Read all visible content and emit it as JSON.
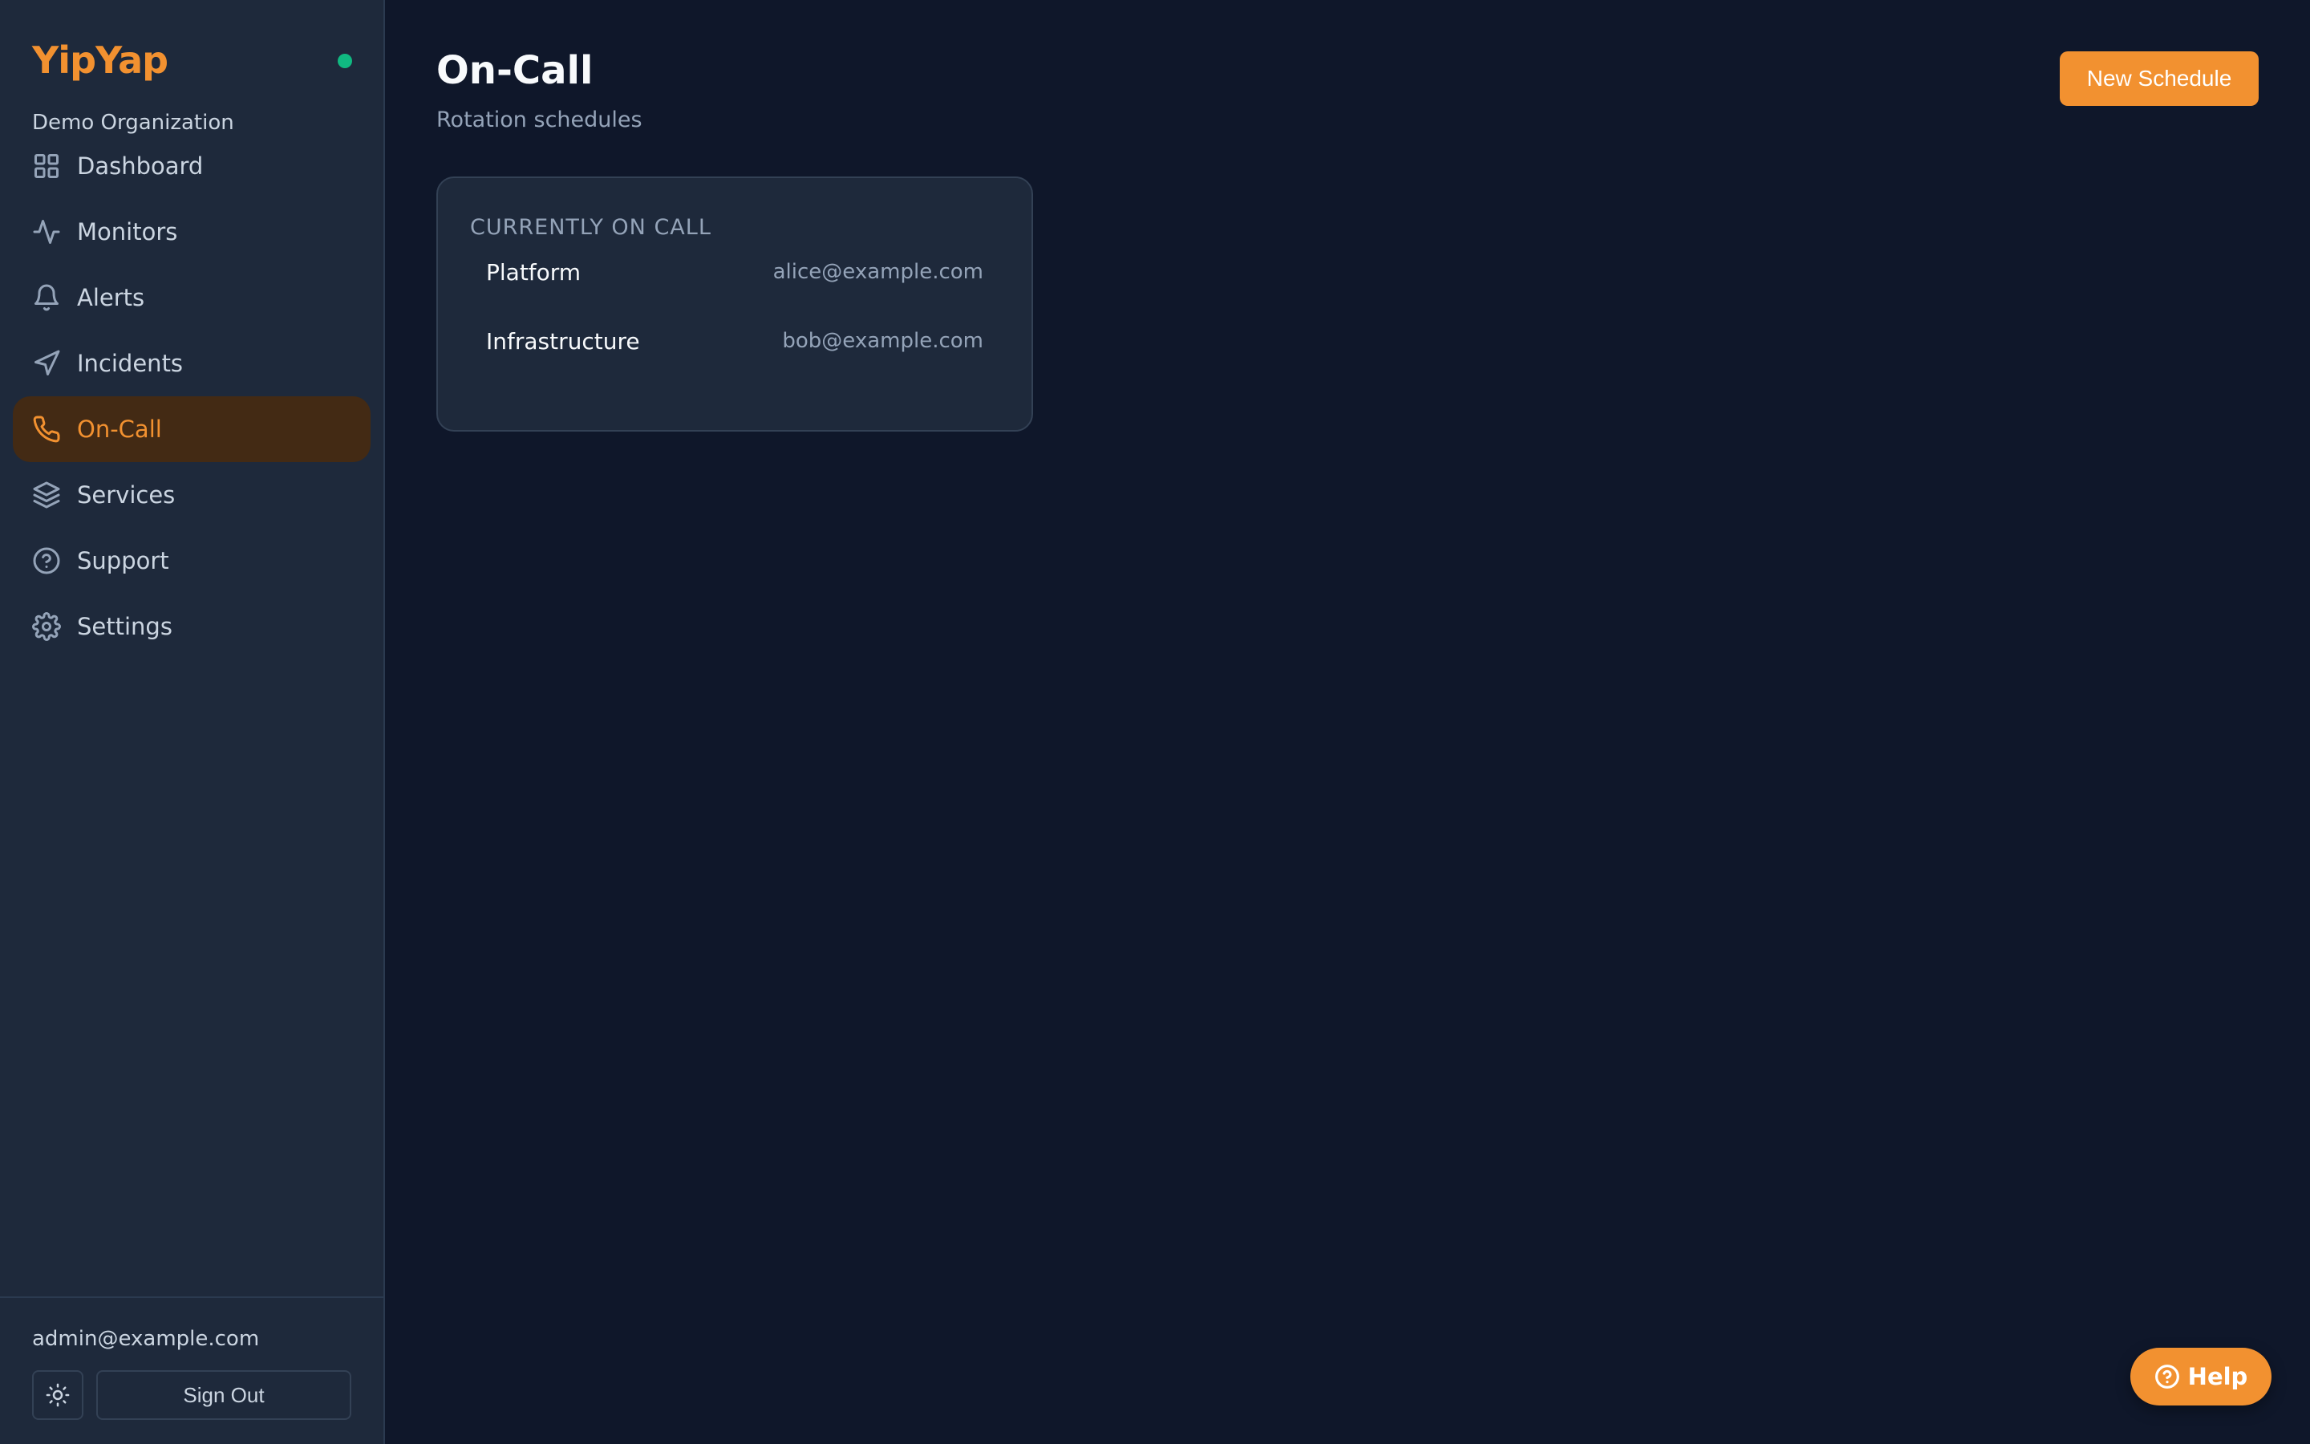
{
  "brand": {
    "name": "YipYap",
    "status": "online",
    "status_color": "#10b981",
    "accent": "#f29130"
  },
  "org": {
    "name": "Demo Organization"
  },
  "nav": {
    "items": [
      {
        "label": "Dashboard",
        "icon": "dashboard-grid-icon"
      },
      {
        "label": "Monitors",
        "icon": "activity-pulse-icon"
      },
      {
        "label": "Alerts",
        "icon": "bell-icon"
      },
      {
        "label": "Incidents",
        "icon": "send-arrow-icon"
      },
      {
        "label": "On-Call",
        "icon": "phone-icon",
        "active": true
      },
      {
        "label": "Services",
        "icon": "layers-icon"
      },
      {
        "label": "Support",
        "icon": "help-circle-icon"
      },
      {
        "label": "Settings",
        "icon": "gear-icon"
      }
    ]
  },
  "footer": {
    "user_email": "admin@example.com",
    "theme_toggle_icon": "sun-icon",
    "sign_out_label": "Sign Out"
  },
  "header": {
    "title": "On-Call",
    "subtitle": "Rotation schedules",
    "new_button_label": "New Schedule"
  },
  "oncall_card": {
    "title": "CURRENTLY ON CALL",
    "rows": [
      {
        "team": "Platform",
        "email": "alice@example.com"
      },
      {
        "team": "Infrastructure",
        "email": "bob@example.com"
      }
    ]
  },
  "help": {
    "label": "Help",
    "icon": "help-circle-icon"
  }
}
